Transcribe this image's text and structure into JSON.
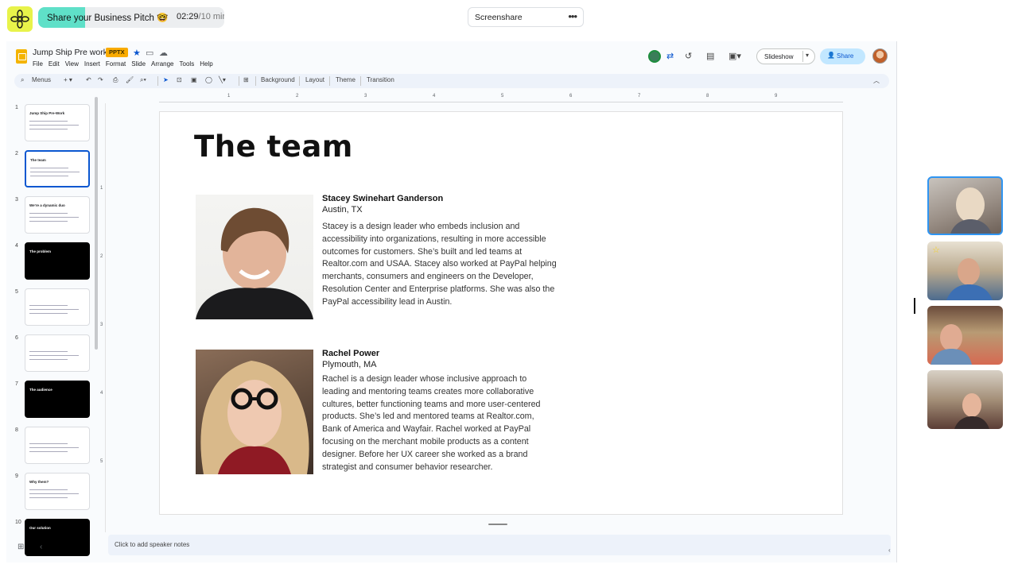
{
  "meeting": {
    "pitch_label": "Share your Business Pitch 🤓",
    "timer_elapsed": "02:29",
    "timer_max": "/10 mins",
    "timer_progress": 0.25,
    "screenshare_label": "Screenshare",
    "more_icon": "more-horizontal-icon"
  },
  "slides_app": {
    "doc_title": "Jump Ship Pre work",
    "file_badge": "PPTX",
    "menu": [
      "File",
      "Edit",
      "View",
      "Insert",
      "Format",
      "Slide",
      "Arrange",
      "Tools",
      "Help"
    ],
    "slideshow_label": "Slideshow",
    "share_label": "Share",
    "toolbar": {
      "menus_label": "Menus",
      "background_label": "Background",
      "layout_label": "Layout",
      "theme_label": "Theme",
      "transition_label": "Transition"
    },
    "ruler_h": [
      "1",
      "2",
      "3",
      "4",
      "5",
      "6",
      "7",
      "8",
      "9"
    ],
    "ruler_v": [
      "1",
      "2",
      "3",
      "4",
      "5"
    ],
    "speaker_notes_placeholder": "Click to add speaker notes"
  },
  "filmstrip": [
    {
      "num": "1",
      "title": "Jump Ship Pre-Work",
      "dark": false
    },
    {
      "num": "2",
      "title": "The team",
      "dark": false
    },
    {
      "num": "3",
      "title": "We're a dynamic duo",
      "dark": false
    },
    {
      "num": "4",
      "title": "The problem",
      "dark": true
    },
    {
      "num": "5",
      "title": "",
      "dark": false
    },
    {
      "num": "6",
      "title": "",
      "dark": false
    },
    {
      "num": "7",
      "title": "The audience",
      "dark": true
    },
    {
      "num": "8",
      "title": "",
      "dark": false
    },
    {
      "num": "9",
      "title": "Why them?",
      "dark": false
    },
    {
      "num": "10",
      "title": "Our solution",
      "dark": true
    }
  ],
  "slide": {
    "title": "The team",
    "people": [
      {
        "name": "Stacey Swinehart Ganderson",
        "location": "Austin, TX",
        "bio": "Stacey is a design leader who embeds inclusion and accessibility into organizations, resulting in more accessible outcomes for customers. She’s built and led teams at Realtor.com and USAA. Stacey also worked at PayPal helping merchants, consumers and engineers on the Developer, Resolution Center and Enterprise platforms. She was also the PayPal accessibility lead in Austin."
      },
      {
        "name": "Rachel Power",
        "location": "Plymouth, MA",
        "bio": "Rachel is a design leader whose inclusive approach to leading and mentoring teams creates more collaborative cultures, better functioning teams and more user-centered products. She’s led and mentored teams at Realtor.com, Bank of America and Wayfair. Rachel worked at PayPal focusing on the merchant mobile products as a content designer. Before her UX career she worked as a brand strategist and consumer behavior researcher."
      }
    ]
  },
  "colors": {
    "accent": "#0b57d0",
    "timer_fill": "#5fe0c8",
    "badge": "#f9ab00",
    "share_bg": "#c2e7ff"
  }
}
